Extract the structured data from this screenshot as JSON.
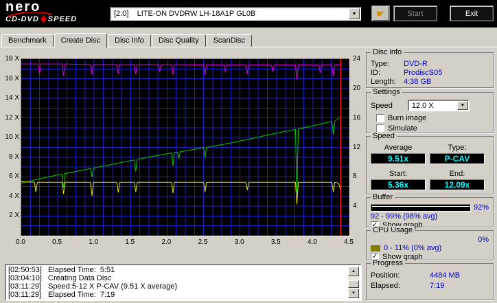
{
  "ui": {
    "check": "✓",
    "arrow_down": "▼",
    "arrow_up": "▲",
    "hand": "☛"
  },
  "colors": {
    "value_blue": "#0000cc",
    "lcd_cyan": "#00ffff",
    "cpu_olive": "#808000",
    "brand_red": "#d40000"
  },
  "header": {
    "brand": {
      "name": "nero",
      "line1": "CD-DVD",
      "line2": "SPEED"
    },
    "drive": "[2:0]    LITE-ON DVDRW LH-18A1P GL0B",
    "start_label": "Start",
    "exit_label": "Exit"
  },
  "tabs": {
    "active": "Create Disc",
    "items": [
      {
        "label": "Benchmark"
      },
      {
        "label": "Create Disc"
      },
      {
        "label": "Disc Info"
      },
      {
        "label": "Disc Quality"
      },
      {
        "label": "ScanDisc"
      }
    ]
  },
  "disc_info": {
    "title": "Disc info",
    "rows": [
      {
        "label": "Type:",
        "value": "DVD-R"
      },
      {
        "label": "ID:",
        "value": "ProdiscS05"
      },
      {
        "label": "Length:",
        "value": "4:38 GB"
      }
    ]
  },
  "settings": {
    "title": "Settings",
    "speed_label": "Speed",
    "speed_value": "12.0 X",
    "burn_image_label": "Burn image",
    "simulate_label": "Simulate"
  },
  "speed": {
    "title": "Speed",
    "average_label": "Average",
    "average_value": "9.51x",
    "type_label": "Type:",
    "type_value": "P-CAV",
    "start_label": "Start:",
    "start_value": "5.36x",
    "end_label": "End:",
    "end_value": "12.09x"
  },
  "buffer": {
    "title": "Buffer",
    "percent": "92%",
    "range": "92 - 99% (98% avg)",
    "show_graph_label": "Show graph"
  },
  "cpu": {
    "title": "CPU Usage",
    "percent": "0%",
    "range": "0 - 11% (0% avg)",
    "show_graph_label": "Show graph"
  },
  "progress": {
    "title": "Progress",
    "position_label": "Position:",
    "position_value": "4484 MB",
    "elapsed_label": "Elapsed:",
    "elapsed_value": "7:19"
  },
  "log": {
    "entries": [
      {
        "time": "[02:50:53]",
        "text": "Elapsed Time:  5:51"
      },
      {
        "time": "[03:04:10]",
        "text": "Creating Data Disc"
      },
      {
        "time": "[03:11:29]",
        "text": "Speed:5-12 X P-CAV (9.51 X average)"
      },
      {
        "time": "[03:11:29]",
        "text": "Elapsed Time:  7:19"
      }
    ]
  },
  "chart_data": {
    "type": "line",
    "title": "",
    "xlim": [
      0,
      4.5
    ],
    "ylim_left": [
      0,
      18
    ],
    "ylim_right": [
      0,
      24
    ],
    "grid": {
      "color": "#2020c8",
      "x_step": 0.125,
      "y_step": 1
    },
    "bg": "#000000",
    "marker_x": 4.38,
    "marker_color": "#ff0000",
    "x_ticks": [
      {
        "label": "0.0",
        "value": 0
      },
      {
        "label": "0.5",
        "value": 0.5
      },
      {
        "label": "1.0",
        "value": 1
      },
      {
        "label": "1.5",
        "value": 1.5
      },
      {
        "label": "2.0",
        "value": 2
      },
      {
        "label": "2.5",
        "value": 2.5
      },
      {
        "label": "3.0",
        "value": 3
      },
      {
        "label": "3.5",
        "value": 3.5
      },
      {
        "label": "4.0",
        "value": 4
      },
      {
        "label": "4.5",
        "value": 4.5
      }
    ],
    "y_ticks_left": [
      {
        "label": "18 X",
        "value": 18
      },
      {
        "label": "16 X",
        "value": 16
      },
      {
        "label": "14 X",
        "value": 14
      },
      {
        "label": "12 X",
        "value": 12
      },
      {
        "label": "10 X",
        "value": 10
      },
      {
        "label": "8 X",
        "value": 8
      },
      {
        "label": "6 X",
        "value": 6
      },
      {
        "label": "4 X",
        "value": 4
      },
      {
        "label": "2 X",
        "value": 2
      }
    ],
    "y_ticks_right": [
      {
        "label": "24",
        "value": 24
      },
      {
        "label": "20",
        "value": 20
      },
      {
        "label": "16",
        "value": 16
      },
      {
        "label": "12",
        "value": 12
      },
      {
        "label": "8",
        "value": 8
      },
      {
        "label": "4",
        "value": 4
      }
    ],
    "series": [
      {
        "name": "write-speed",
        "color": "#00cc00",
        "axis": "left",
        "points": [
          [
            0,
            5.35
          ],
          [
            0.25,
            5.8
          ],
          [
            0.5,
            6.2
          ],
          [
            0.56,
            6.28
          ],
          [
            0.58,
            4.85
          ],
          [
            0.6,
            6.33
          ],
          [
            0.8,
            6.62
          ],
          [
            0.95,
            6.85
          ],
          [
            0.97,
            5.95
          ],
          [
            0.99,
            6.9
          ],
          [
            1.2,
            7.2
          ],
          [
            1.4,
            7.5
          ],
          [
            1.55,
            7.72
          ],
          [
            1.57,
            6.55
          ],
          [
            1.59,
            7.78
          ],
          [
            1.8,
            8.08
          ],
          [
            2.0,
            8.35
          ],
          [
            2.06,
            8.43
          ],
          [
            2.08,
            7.1
          ],
          [
            2.1,
            8.48
          ],
          [
            2.14,
            8.52
          ],
          [
            2.16,
            7.85
          ],
          [
            2.18,
            8.55
          ],
          [
            2.4,
            8.85
          ],
          [
            2.5,
            8.98
          ],
          [
            2.52,
            7.95
          ],
          [
            2.54,
            9.0
          ],
          [
            2.8,
            9.35
          ],
          [
            3.1,
            9.8
          ],
          [
            3.4,
            10.3
          ],
          [
            3.7,
            10.75
          ],
          [
            3.76,
            10.82
          ],
          [
            3.78,
            4.4
          ],
          [
            3.8,
            10.88
          ],
          [
            4.0,
            11.2
          ],
          [
            4.2,
            11.55
          ],
          [
            4.26,
            11.63
          ],
          [
            4.28,
            10.3
          ],
          [
            4.3,
            11.7
          ],
          [
            4.38,
            12.09
          ]
        ]
      },
      {
        "name": "aux-speed",
        "color": "#e6e600",
        "axis": "left",
        "points": [
          [
            0,
            5.5
          ],
          [
            0.18,
            5.45
          ],
          [
            0.2,
            4.45
          ],
          [
            0.22,
            5.45
          ],
          [
            0.56,
            5.45
          ],
          [
            0.58,
            4.25
          ],
          [
            0.6,
            5.45
          ],
          [
            0.95,
            5.45
          ],
          [
            0.97,
            4.05
          ],
          [
            0.99,
            5.45
          ],
          [
            1.31,
            5.45
          ],
          [
            1.33,
            4.4
          ],
          [
            1.35,
            5.45
          ],
          [
            1.55,
            5.45
          ],
          [
            1.57,
            4.45
          ],
          [
            1.59,
            5.45
          ],
          [
            2.06,
            5.45
          ],
          [
            2.08,
            4.35
          ],
          [
            2.1,
            5.45
          ],
          [
            2.5,
            5.45
          ],
          [
            2.52,
            4.45
          ],
          [
            2.54,
            5.45
          ],
          [
            3.08,
            5.45
          ],
          [
            3.1,
            4.65
          ],
          [
            3.12,
            5.45
          ],
          [
            3.76,
            5.45
          ],
          [
            3.78,
            3.2
          ],
          [
            3.8,
            5.45
          ],
          [
            4.26,
            5.45
          ],
          [
            4.28,
            4.45
          ],
          [
            4.3,
            5.45
          ],
          [
            4.35,
            5.35
          ],
          [
            4.38,
            4.7
          ]
        ]
      },
      {
        "name": "buffer-level",
        "color": "#dd00dd",
        "axis": "left",
        "points": [
          [
            0,
            17.5
          ],
          [
            0.23,
            17.5
          ],
          [
            0.25,
            16.5
          ],
          [
            0.27,
            17.5
          ],
          [
            0.56,
            17.5
          ],
          [
            0.58,
            16.3
          ],
          [
            0.6,
            17.5
          ],
          [
            0.95,
            17.45
          ],
          [
            0.97,
            16.4
          ],
          [
            0.99,
            17.45
          ],
          [
            1.31,
            17.45
          ],
          [
            1.33,
            16.5
          ],
          [
            1.35,
            17.45
          ],
          [
            1.55,
            17.45
          ],
          [
            1.57,
            16.45
          ],
          [
            1.59,
            17.45
          ],
          [
            1.88,
            17.45
          ],
          [
            1.9,
            16.7
          ],
          [
            1.92,
            17.45
          ],
          [
            2.06,
            17.45
          ],
          [
            2.08,
            16.4
          ],
          [
            2.1,
            17.45
          ],
          [
            2.5,
            17.4
          ],
          [
            2.52,
            16.4
          ],
          [
            2.54,
            17.4
          ],
          [
            2.78,
            17.4
          ],
          [
            2.8,
            16.7
          ],
          [
            2.82,
            17.4
          ],
          [
            3.08,
            17.4
          ],
          [
            3.1,
            16.5
          ],
          [
            3.12,
            17.4
          ],
          [
            3.43,
            17.4
          ],
          [
            3.45,
            16.7
          ],
          [
            3.47,
            17.4
          ],
          [
            3.76,
            17.4
          ],
          [
            3.78,
            15.9
          ],
          [
            3.8,
            17.4
          ],
          [
            4.08,
            17.4
          ],
          [
            4.1,
            16.6
          ],
          [
            4.12,
            17.4
          ],
          [
            4.26,
            17.4
          ],
          [
            4.28,
            16.2
          ],
          [
            4.3,
            17.4
          ],
          [
            4.38,
            17.4
          ]
        ]
      }
    ]
  }
}
